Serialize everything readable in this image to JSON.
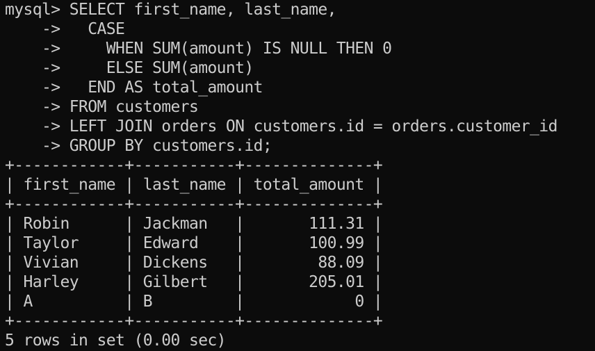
{
  "colors": {
    "background": "#0c0c0c",
    "foreground": "#cccccc"
  },
  "terminal": {
    "lines": [
      "mysql> SELECT first_name, last_name,",
      "    ->   CASE",
      "    ->     WHEN SUM(amount) IS NULL THEN 0",
      "    ->     ELSE SUM(amount)",
      "    ->   END AS total_amount",
      "    -> FROM customers",
      "    -> LEFT JOIN orders ON customers.id = orders.customer_id",
      "    -> GROUP BY customers.id;",
      "+------------+-----------+--------------+",
      "| first_name | last_name | total_amount |",
      "+------------+-----------+--------------+",
      "| Robin      | Jackman   |       111.31 |",
      "| Taylor     | Edward    |       100.99 |",
      "| Vivian     | Dickens   |        88.09 |",
      "| Harley     | Gilbert   |       205.01 |",
      "| A          | B         |            0 |",
      "+------------+-----------+--------------+",
      "5 rows in set (0.00 sec)"
    ]
  }
}
